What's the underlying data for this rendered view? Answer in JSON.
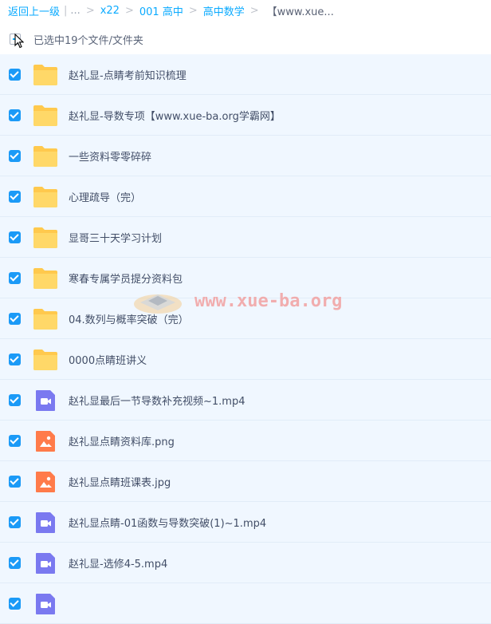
{
  "breadcrumb": {
    "back": "返回上一级",
    "divider": "|",
    "ellipsis": "...",
    "sep": ">",
    "items": [
      "x22",
      "001 高中",
      "高中数学"
    ],
    "current": "【www.xue..."
  },
  "selection": {
    "text": "已选中19个文件/文件夹"
  },
  "files": [
    {
      "name": "赵礼显-点睛考前知识梳理",
      "type": "folder"
    },
    {
      "name": "赵礼显-导数专项【www.xue-ba.org学霸网】",
      "type": "folder"
    },
    {
      "name": "一些资料零零碎碎",
      "type": "folder"
    },
    {
      "name": "心理疏导（完）",
      "type": "folder"
    },
    {
      "name": "显哥三十天学习计划",
      "type": "folder"
    },
    {
      "name": "寒春专属学员提分资料包",
      "type": "folder"
    },
    {
      "name": "04.数列与概率突破（完）",
      "type": "folder"
    },
    {
      "name": "0000点睛班讲义",
      "type": "folder"
    },
    {
      "name": "赵礼显最后一节导数补充视频~1.mp4",
      "type": "video"
    },
    {
      "name": "赵礼显点睛资料库.png",
      "type": "image"
    },
    {
      "name": "赵礼显点睛班课表.jpg",
      "type": "image"
    },
    {
      "name": "赵礼显点睛-01函数与导数突破(1)~1.mp4",
      "type": "video"
    },
    {
      "name": "赵礼显-选修4-5.mp4",
      "type": "video"
    },
    {
      "name": "",
      "type": "video"
    }
  ],
  "watermark": {
    "text": "www.xue-ba.org"
  },
  "colors": {
    "accent": "#09aaff",
    "checkbox": "#1b9af7",
    "row_bg": "#f0f7ff",
    "folder": "#ffc94d",
    "video": "#7a79f0",
    "image": "#ff7b4a"
  }
}
